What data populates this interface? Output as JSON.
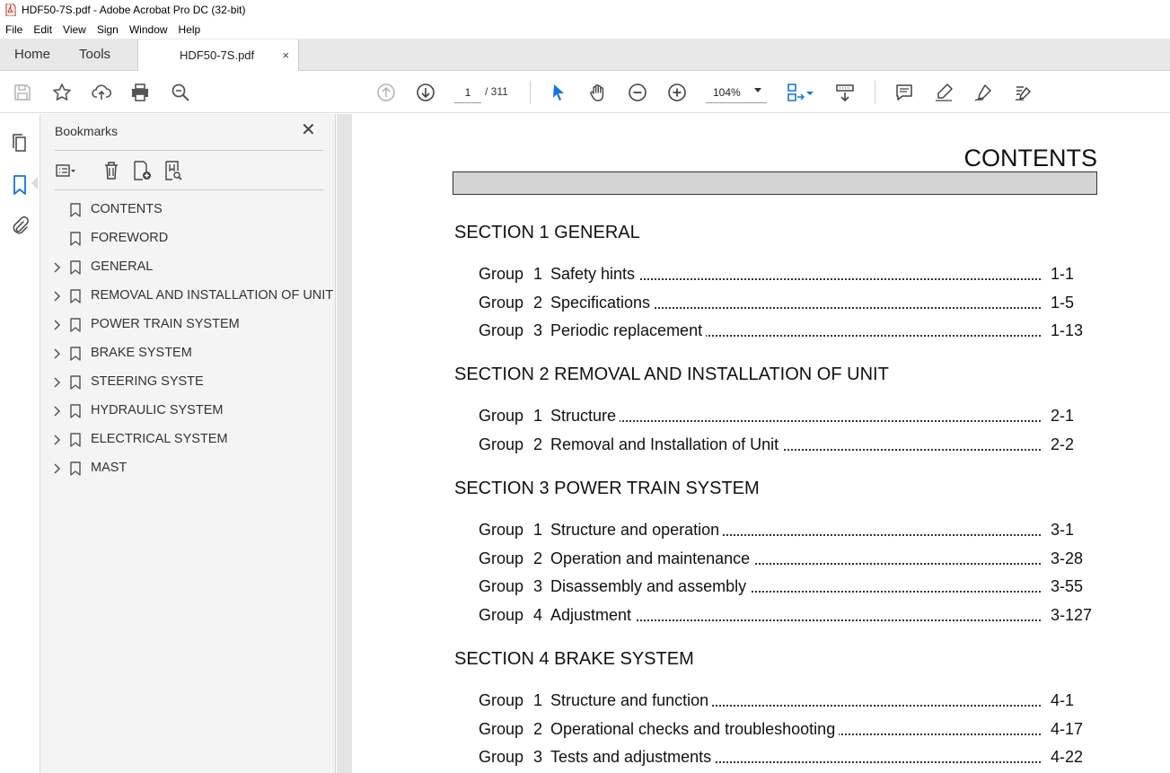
{
  "window": {
    "title": "HDF50-7S.pdf - Adobe Acrobat Pro DC (32-bit)"
  },
  "menu": [
    "File",
    "Edit",
    "View",
    "Sign",
    "Window",
    "Help"
  ],
  "tabs": {
    "home": "Home",
    "tools": "Tools",
    "document": "HDF50-7S.pdf",
    "close": "×"
  },
  "toolbar": {
    "page_current": "1",
    "page_total": "/ 311",
    "zoom": "104%"
  },
  "bookmarks": {
    "header": "Bookmarks",
    "close": "✕",
    "items": [
      {
        "label": "CONTENTS",
        "expandable": false
      },
      {
        "label": "FOREWORD",
        "expandable": false
      },
      {
        "label": "GENERAL",
        "expandable": true
      },
      {
        "label": "REMOVAL AND INSTALLATION OF UNIT",
        "expandable": true
      },
      {
        "label": "POWER TRAIN SYSTEM",
        "expandable": true
      },
      {
        "label": "BRAKE SYSTEM",
        "expandable": true
      },
      {
        "label": "STEERING SYSTE",
        "expandable": true
      },
      {
        "label": "HYDRAULIC SYSTEM",
        "expandable": true
      },
      {
        "label": "ELECTRICAL SYSTEM",
        "expandable": true
      },
      {
        "label": "MAST",
        "expandable": true
      }
    ]
  },
  "document": {
    "title": "CONTENTS",
    "sections": [
      {
        "heading": "SECTION 1  GENERAL",
        "groups": [
          {
            "word": "Group",
            "num": "1",
            "title": "Safety hints",
            "page": "1-1"
          },
          {
            "word": "Group",
            "num": "2",
            "title": "Specifications",
            "page": "1-5"
          },
          {
            "word": "Group",
            "num": "3",
            "title": "Periodic replacement",
            "page": "1-13"
          }
        ]
      },
      {
        "heading": "SECTION 2  REMOVAL AND INSTALLATION OF UNIT",
        "groups": [
          {
            "word": "Group",
            "num": "1",
            "title": "Structure",
            "page": "2-1"
          },
          {
            "word": "Group",
            "num": "2",
            "title": "Removal and Installation of Unit",
            "page": "2-2"
          }
        ]
      },
      {
        "heading": "SECTION 3  POWER TRAIN SYSTEM",
        "groups": [
          {
            "word": "Group",
            "num": "1",
            "title": "Structure and operation",
            "page": "3-1"
          },
          {
            "word": "Group",
            "num": "2",
            "title": "Operation and maintenance",
            "page": "3-28"
          },
          {
            "word": "Group",
            "num": "3",
            "title": "Disassembly and assembly",
            "page": "3-55"
          },
          {
            "word": "Group",
            "num": "4",
            "title": "Adjustment",
            "page": "3-127"
          }
        ]
      },
      {
        "heading": "SECTION 4  BRAKE SYSTEM",
        "groups": [
          {
            "word": "Group",
            "num": "1",
            "title": "Structure and function",
            "page": "4-1"
          },
          {
            "word": "Group",
            "num": "2",
            "title": "Operational checks and troubleshooting",
            "page": "4-17"
          },
          {
            "word": "Group",
            "num": "3",
            "title": "Tests and adjustments",
            "page": "4-22"
          }
        ]
      }
    ]
  },
  "colors": {
    "accent": "#1473e6",
    "panel": "#f4f4f4",
    "tabbar": "#e8e8e8",
    "doc_bg": "#e4e4e4",
    "title_bar_fill": "#d4d4d4"
  }
}
